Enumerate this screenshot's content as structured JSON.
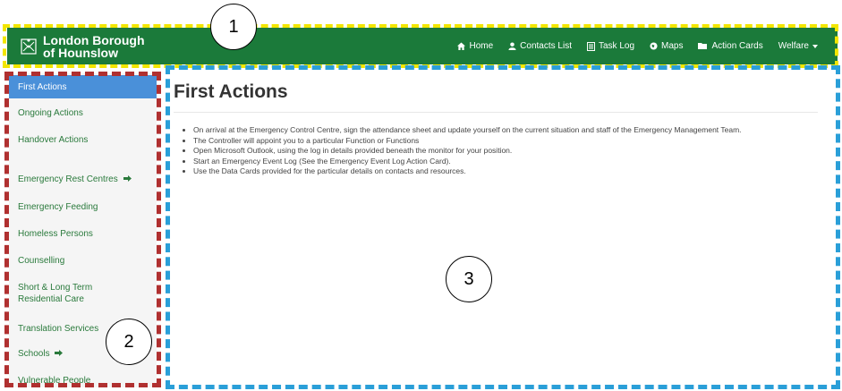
{
  "navbar": {
    "brand_line1": "London Borough",
    "brand_line2": "of Hounslow",
    "links": [
      {
        "label": "Home",
        "icon": "home-icon"
      },
      {
        "label": "Contacts List",
        "icon": "user-icon"
      },
      {
        "label": "Task Log",
        "icon": "list-icon"
      },
      {
        "label": "Maps",
        "icon": "globe-icon"
      },
      {
        "label": "Action Cards",
        "icon": "folder-icon"
      },
      {
        "label": "Welfare",
        "icon": "caret-down-icon"
      }
    ]
  },
  "sidebar": {
    "items": [
      {
        "label": "First Actions"
      },
      {
        "label": "Ongoing Actions"
      },
      {
        "label": "Handover Actions"
      },
      {
        "label": "Emergency Rest Centres"
      },
      {
        "label": "Emergency Feeding"
      },
      {
        "label": "Homeless Persons"
      },
      {
        "label": "Counselling"
      },
      {
        "label": "Short & Long Term"
      },
      {
        "label": "Residential Care"
      },
      {
        "label": "Translation Services"
      },
      {
        "label": "Schools"
      },
      {
        "label": "Vulnerable People"
      }
    ]
  },
  "main": {
    "title": "First Actions",
    "bullets": [
      "On arrival at the Emergency Control Centre, sign the attendance sheet and update yourself on the current situation and staff of the Emergency Management Team.",
      "The Controller will appoint you to a particular Function or Functions",
      "Open Microsoft Outlook, using the log in details provided beneath the monitor for your position.",
      "Start an Emergency Event Log (See the Emergency Event Log Action Card).",
      "Use the Data Cards provided for the particular details on contacts and resources."
    ]
  },
  "annotations": {
    "one": "1",
    "two": "2",
    "three": "3"
  },
  "colors": {
    "navbar_green": "#1b7a3a",
    "active_blue": "#4a90d9",
    "link_green": "#2a7a3c",
    "yellow_annotation": "#f2e600",
    "red_annotation": "#b03030",
    "blue_annotation": "#2a9fd8"
  }
}
